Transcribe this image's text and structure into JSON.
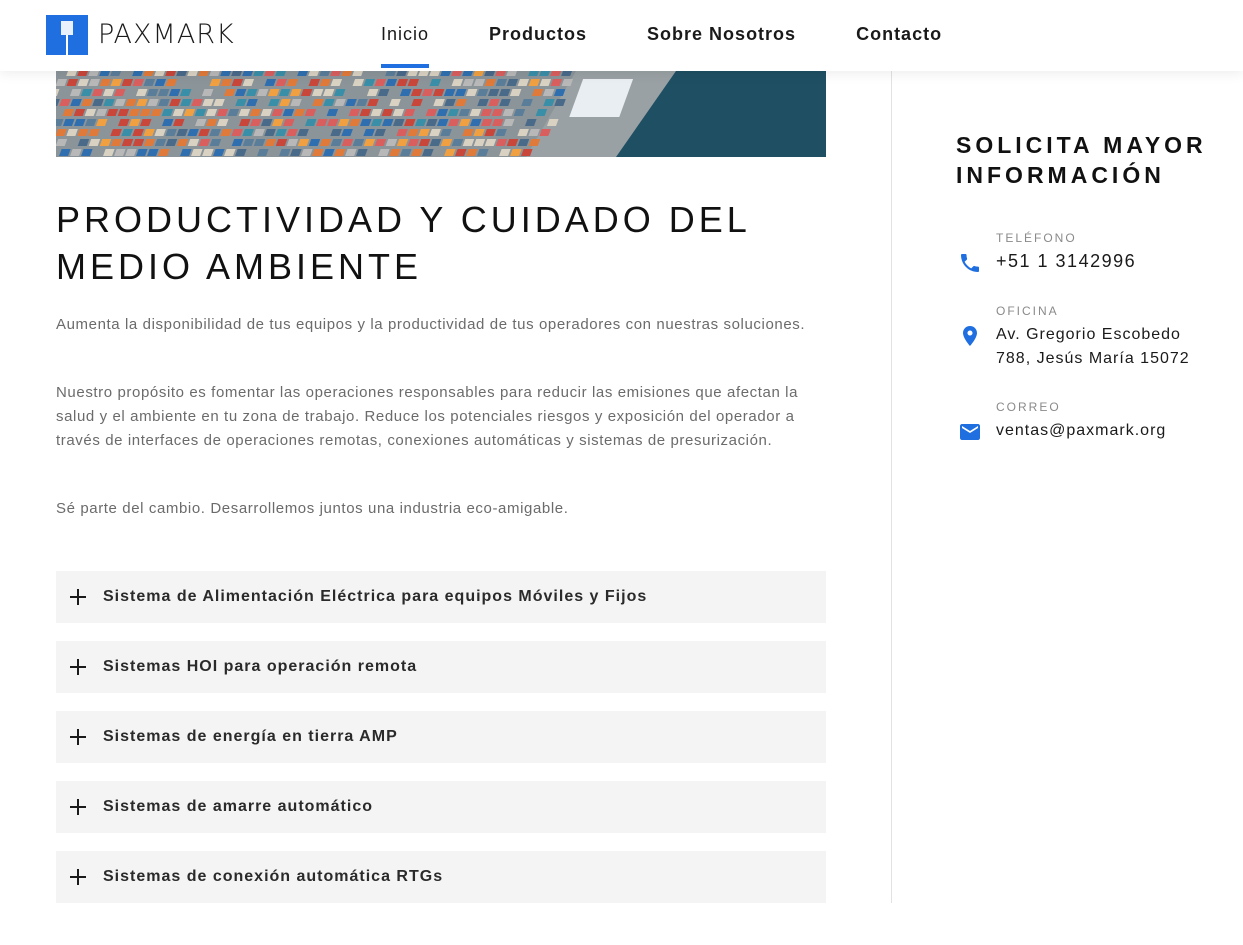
{
  "brand": {
    "name": "PAXMARK",
    "accent_color": "#1f6fe0"
  },
  "nav": {
    "items": [
      {
        "label": "Inicio",
        "active": true
      },
      {
        "label": "Productos",
        "active": false
      },
      {
        "label": "Sobre Nosotros",
        "active": false
      },
      {
        "label": "Contacto",
        "active": false
      }
    ]
  },
  "hero": {
    "image": "port-containers-aerial"
  },
  "main": {
    "title": "PRODUCTIVIDAD Y CUIDADO DEL MEDIO AMBIENTE",
    "paragraphs": [
      "Aumenta la disponibilidad de tus equipos y la productividad de tus operadores con nuestras soluciones.",
      "Nuestro propósito es fomentar las operaciones responsables para reducir las emisiones que afectan la salud y el ambiente en tu zona de trabajo. Reduce los potenciales riesgos y exposición del operador a través de interfaces de operaciones remotas, conexiones automáticas y sistemas de presurización.",
      "Sé parte del cambio. Desarrollemos juntos una industria eco-amigable."
    ],
    "accordion": [
      {
        "label": "Sistema de Alimentación Eléctrica para equipos Móviles y Fijos",
        "icon": "plus-icon"
      },
      {
        "label": "Sistemas HOI para operación remota",
        "icon": "plus-icon"
      },
      {
        "label": "Sistemas de energía en tierra AMP",
        "icon": "plus-icon"
      },
      {
        "label": "Sistemas de amarre automático",
        "icon": "plus-icon"
      },
      {
        "label": "Sistemas de conexión automática RTGs",
        "icon": "plus-icon"
      }
    ]
  },
  "sidebar": {
    "title": "SOLICITA MAYOR INFORMACIÓN",
    "phone": {
      "label": "TELÉFONO",
      "value": "+51 1 3142996",
      "icon": "phone-icon"
    },
    "office": {
      "label": "OFICINA",
      "value_line1": "Av. Gregorio Escobedo",
      "value_line2": "788, Jesús María 15072",
      "icon": "location-pin-icon"
    },
    "email": {
      "label": "CORREO",
      "value": "ventas@paxmark.org",
      "icon": "mail-icon"
    }
  }
}
